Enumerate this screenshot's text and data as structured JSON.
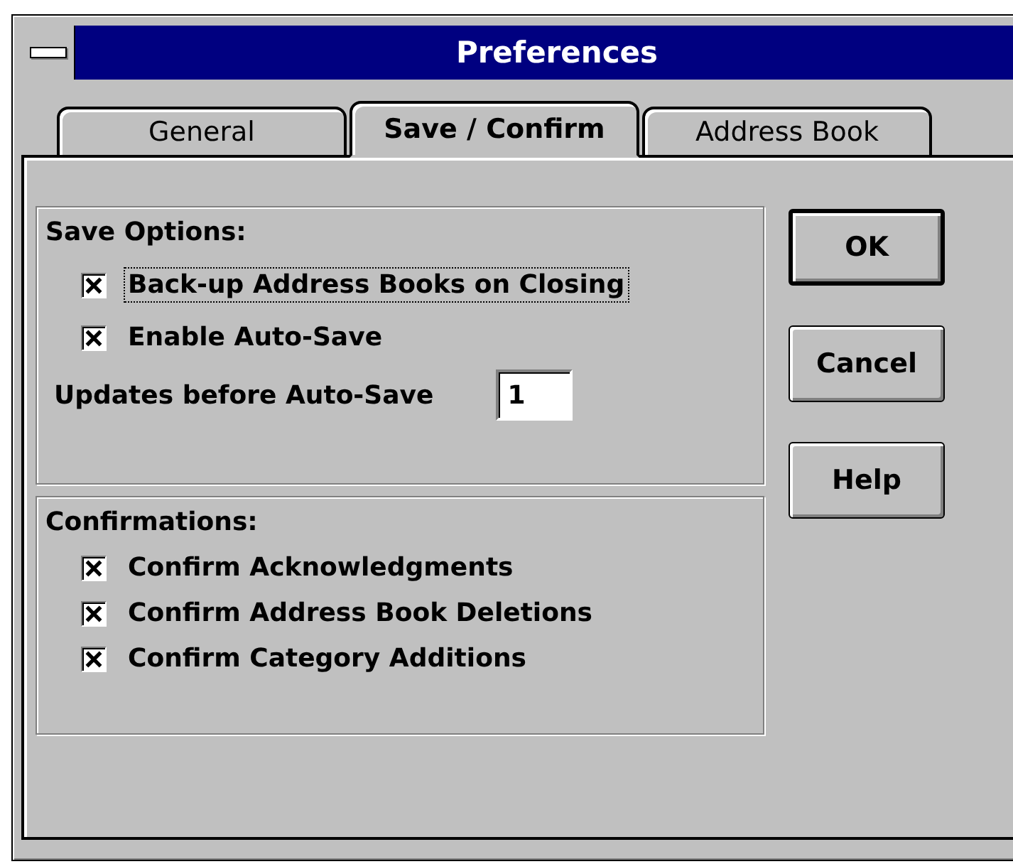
{
  "window": {
    "title": "Preferences"
  },
  "tabs": [
    {
      "label": "General",
      "selected": false
    },
    {
      "label": "Save / Confirm",
      "selected": true
    },
    {
      "label": "Address Book",
      "selected": false
    }
  ],
  "save_options": {
    "heading": "Save Options:",
    "checkboxes": [
      {
        "label": "Back-up Address Books on Closing",
        "checked": true,
        "focused": true
      },
      {
        "label": "Enable Auto-Save",
        "checked": true,
        "focused": false
      }
    ],
    "updates_field": {
      "label": "Updates before Auto-Save",
      "value": "1"
    }
  },
  "confirmations": {
    "heading": "Confirmations:",
    "checkboxes": [
      {
        "label": "Confirm Acknowledgments",
        "checked": true
      },
      {
        "label": "Confirm Address Book Deletions",
        "checked": true
      },
      {
        "label": "Confirm Category Additions",
        "checked": true
      }
    ]
  },
  "buttons": [
    {
      "label": "OK",
      "default": true
    },
    {
      "label": "Cancel",
      "default": false
    },
    {
      "label": "Help",
      "default": false
    }
  ]
}
